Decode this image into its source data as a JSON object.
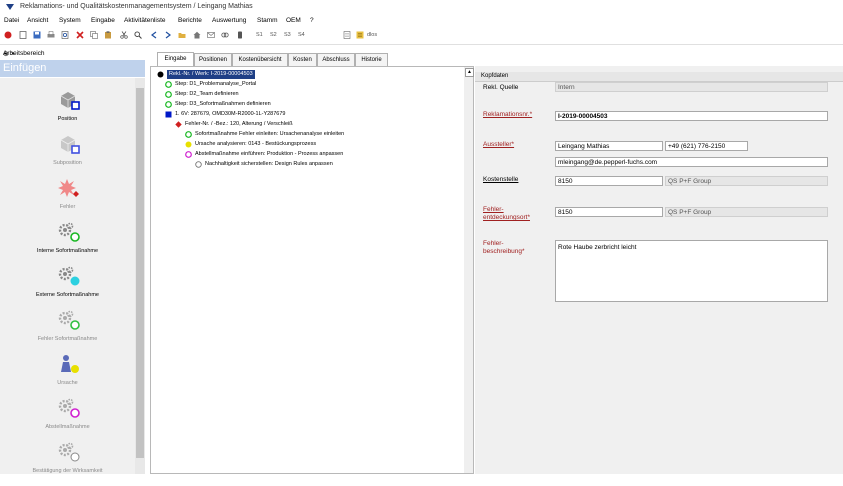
{
  "window": {
    "title": "Reklamations- und Qualitätskostenmanagementsystem / Leingang Mathias"
  },
  "menu": [
    "Datei",
    "Ansicht",
    "System",
    "Eingabe",
    "Aktivitätenliste",
    "Berichte",
    "Auswertung",
    "Stamm",
    "OEM",
    "?"
  ],
  "toolbar": {
    "icons": [
      "stop-icon",
      "new-icon",
      "save-icon",
      "print-icon",
      "preview-icon",
      "delete-icon",
      "copy-icon",
      "paste-icon",
      "cut-icon",
      "search-icon",
      "back-icon",
      "forward-icon",
      "folder-icon",
      "home-icon",
      "mail-icon",
      "link-icon",
      "phone-icon"
    ],
    "s1": "S1",
    "s2": "S2",
    "s3": "S3",
    "s4": "S4",
    "dlos": "dlos"
  },
  "sidebar": {
    "header": "Arbeitsbereich",
    "pin": "⊕ ×",
    "title": "Einfügen",
    "items": [
      {
        "label": "Position",
        "enabled": true,
        "accent": "#0018c8"
      },
      {
        "label": "Subposition",
        "enabled": false,
        "accent": "#4050e0"
      },
      {
        "label": "Fehler",
        "enabled": false,
        "accent": "#d02020"
      },
      {
        "label": "Interne Sofortmaßnahme",
        "enabled": true,
        "accent": "#19b823"
      },
      {
        "label": "Externe Sofortmaßnahme",
        "enabled": true,
        "accent": "#2cd0e0"
      },
      {
        "label": "Fehler Sofortmaßnahme",
        "enabled": false,
        "accent": "#30c040"
      },
      {
        "label": "Ursache",
        "enabled": false,
        "accent": "#e8e000"
      },
      {
        "label": "Abstellmaßnahme",
        "enabled": false,
        "accent": "#d020d0"
      },
      {
        "label": "Bestätigung der Wirksamkeit",
        "enabled": false,
        "accent": "#ffffff"
      }
    ]
  },
  "tabs": [
    "Eingabe",
    "Positionen",
    "Kostenübersicht",
    "Kosten",
    "Abschluss",
    "Historie"
  ],
  "tree": [
    {
      "label": "Rekl.-Nr. / Werk: I-2019-00004503",
      "marker": "black-circle",
      "color": "#000000",
      "selected": true,
      "indent": 0
    },
    {
      "label": "Step: D1_Problemanalyse_Portal",
      "marker": "circle",
      "color": "#19b823",
      "selected": false,
      "indent": 1
    },
    {
      "label": "Step: D2_Team definieren",
      "marker": "circle",
      "color": "#19b823",
      "selected": false,
      "indent": 1
    },
    {
      "label": "Step: D3_Sofortmaßnahmen definieren",
      "marker": "circle",
      "color": "#19b823",
      "selected": false,
      "indent": 1
    },
    {
      "label": "1. 6V: 287679, OMD30M-R2000-1L-Y287679",
      "marker": "square",
      "color": "#0018c8",
      "selected": false,
      "indent": 1
    },
    {
      "label": "Fehler-Nr. / -Bez.: 120, Alterung / Verschleiß",
      "marker": "diamond",
      "color": "#d02020",
      "selected": false,
      "indent": 2
    },
    {
      "label": "Sofortmaßnahme Fehler einleiten: Ursachenanalyse einleiten",
      "marker": "circle",
      "color": "#19b823",
      "selected": false,
      "indent": 3
    },
    {
      "label": "Ursache analysieren: 0143 - Bestückungsprozess",
      "marker": "dot",
      "color": "#e8e000",
      "selected": false,
      "indent": 3
    },
    {
      "label": "Abstellmaßnahme einführen: Produktion - Prozess anpassen",
      "marker": "circle",
      "color": "#d020d0",
      "selected": false,
      "indent": 3
    },
    {
      "label": "Nachhaltigkeit sicherstellen: Design Rules anpassen",
      "marker": "circle",
      "color": "#777777",
      "selected": false,
      "indent": 4
    }
  ],
  "tree_scroll_arrow": "▲",
  "form": {
    "section": "Kopfdaten",
    "quelle_label": "Rekl. Quelle",
    "quelle_value": "Intern",
    "reklnr_label": "Reklamationsnr.*",
    "reklnr_value": "I-2019-00004503",
    "aussteller_label": "Aussteller*",
    "aussteller_name": "Leingang Mathias",
    "aussteller_phone": "+49 (621) 776-2150",
    "aussteller_email": "mleingang@de.pepperl-fuchs.com",
    "kostenstelle_label": "Kostenstelle",
    "kostenstelle_value": "8150",
    "kostenstelle_group": "QS P+F Group",
    "fehlerort_label": "Fehler-entdeckungsort*",
    "fehlerort_value": "8150",
    "fehlerort_group": "QS P+F Group",
    "beschreibung_label": "Fehler-beschreibung*",
    "beschreibung_value": "Rote Haube zerbricht leicht"
  }
}
